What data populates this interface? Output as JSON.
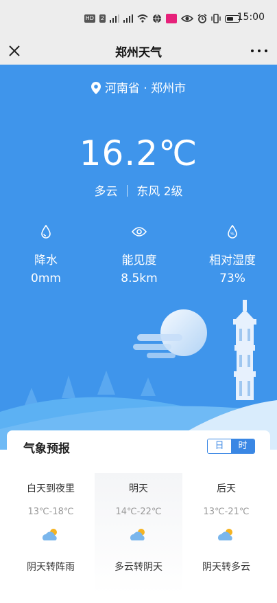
{
  "status_bar": {
    "time": "15:00",
    "chips": [
      "HD",
      "2"
    ]
  },
  "title_bar": {
    "title": "郑州天气"
  },
  "weather": {
    "location": "河南省 · 郑州市",
    "temperature": "16.2℃",
    "condition": "多云 ｜ 东风 2级",
    "metrics": [
      {
        "icon": "raindrop-icon",
        "label": "降水",
        "value": "0mm"
      },
      {
        "icon": "eye-icon",
        "label": "能见度",
        "value": "8.5km"
      },
      {
        "icon": "humidity-icon",
        "label": "相对湿度",
        "value": "73%"
      }
    ]
  },
  "forecast": {
    "title": "气象预报",
    "toggle": {
      "day": "日",
      "hour": "时",
      "selected": "hour"
    },
    "days": [
      {
        "day": "白天到夜里",
        "temp": "13℃-18℃",
        "icon": "partly-cloudy-icon",
        "desc": "阴天转阵雨"
      },
      {
        "day": "明天",
        "temp": "14℃-22℃",
        "icon": "partly-cloudy-icon",
        "desc": "多云转阴天"
      },
      {
        "day": "后天",
        "temp": "13℃-21℃",
        "icon": "partly-cloudy-icon",
        "desc": "阴天转多云"
      }
    ]
  },
  "colors": {
    "hero_bg": "#3f95eb",
    "accent": "#3a87e4",
    "bar_bg": "#ededed"
  }
}
